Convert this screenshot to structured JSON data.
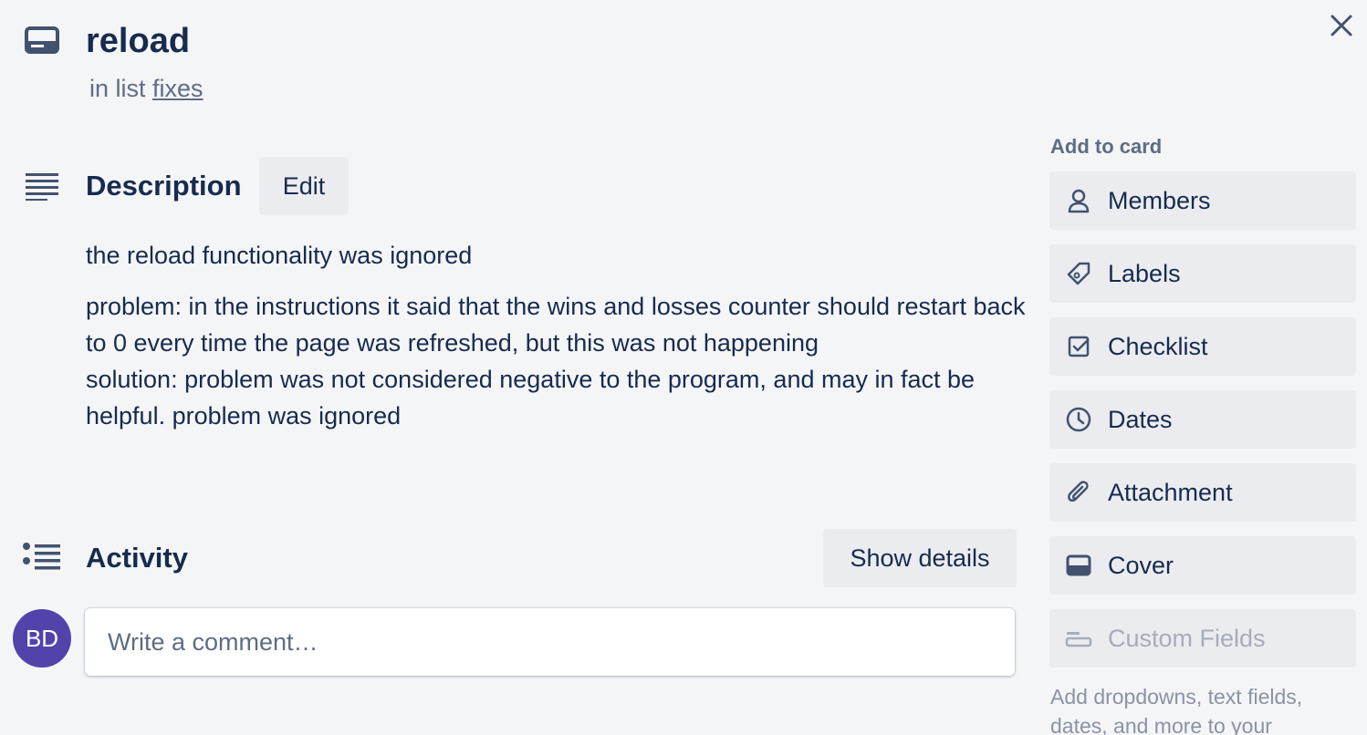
{
  "card": {
    "title": "reload",
    "list_prefix": "in list",
    "list_name": "fixes"
  },
  "description": {
    "heading": "Description",
    "edit_label": "Edit",
    "paragraph1": "the reload functionality was ignored",
    "paragraph2_line1": "problem: in the instructions it said that the wins and losses counter should restart back to 0 every time the page was refreshed, but this was not happening",
    "paragraph2_line2": "solution: problem was not considered negative to the program, and may in fact be helpful. problem was ignored"
  },
  "activity": {
    "heading": "Activity",
    "show_details_label": "Show details",
    "avatar_initials": "BD",
    "comment_placeholder": "Write a comment…"
  },
  "sidebar": {
    "heading": "Add to card",
    "buttons": [
      {
        "label": "Members",
        "icon": "person-icon"
      },
      {
        "label": "Labels",
        "icon": "tag-icon"
      },
      {
        "label": "Checklist",
        "icon": "checkbox-icon"
      },
      {
        "label": "Dates",
        "icon": "clock-icon"
      },
      {
        "label": "Attachment",
        "icon": "paperclip-icon"
      },
      {
        "label": "Cover",
        "icon": "cover-icon"
      },
      {
        "label": "Custom Fields",
        "icon": "custom-fields-icon",
        "disabled": true
      }
    ],
    "note": "Add dropdowns, text fields, dates, and more to your"
  },
  "colors": {
    "background": "#f4f5f7",
    "button_bg": "#ebecf0",
    "text_primary": "#172b4d",
    "text_secondary": "#5e6c84",
    "avatar_bg": "#5243aa"
  }
}
